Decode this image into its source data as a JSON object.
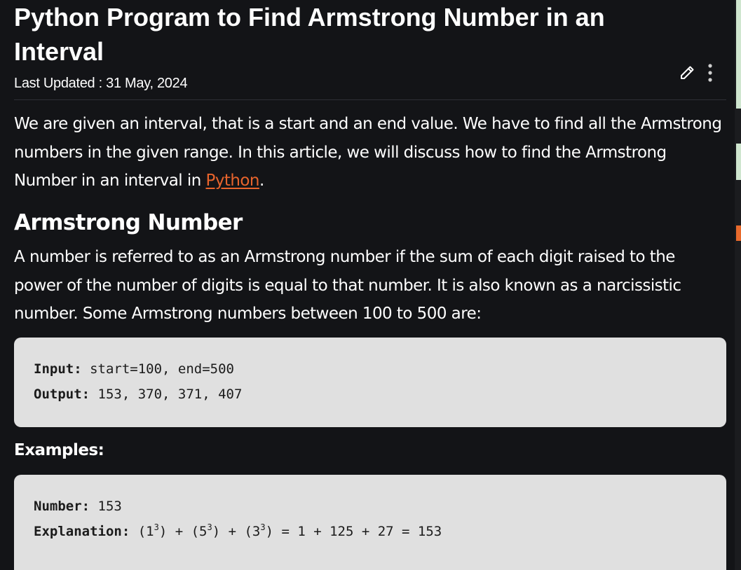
{
  "article": {
    "title": "Python Program to Find Armstrong Number in an Interval",
    "last_updated_label": "Last Updated :",
    "last_updated_date": "31 May, 2024",
    "intro_before_link": "We are given an interval, that is a start and an end value. We have to find all the Armstrong numbers in the given range. In this article, we will discuss how to find the Armstrong Number in an interval in ",
    "intro_link": "Python",
    "intro_after_link": ".",
    "section_heading": "Armstrong Number",
    "section_text": "A number is referred to as an Armstrong number if the sum of each digit raised to the power of the number of digits is equal to that number. It is also known as a narcissistic number. Some Armstrong numbers between 100 to 500 are:",
    "examples_heading": "Examples:"
  },
  "code_block_1": {
    "input_label": "Input:",
    "input_value": " start=100, end=500",
    "output_label": "Output:",
    "output_value": " 153, 370, 371, 407"
  },
  "code_block_2": {
    "number_label": "Number:",
    "number_value": " 153",
    "explanation_label": "Explanation:",
    "expr": {
      "p1_open": " (1",
      "p1_exp": "3",
      "p2_open": ") + (5",
      "p2_exp": "3",
      "p3_open": ") + (3",
      "p3_exp": "3",
      "tail": ") = 1 + 125 + 27 = 153"
    }
  },
  "icons": {
    "edit": "pencil-icon",
    "more": "more-vertical-icon"
  },
  "colors": {
    "background": "#131417",
    "text": "#ffffff",
    "link": "#e8642c",
    "code_background": "#e0e0e0"
  }
}
